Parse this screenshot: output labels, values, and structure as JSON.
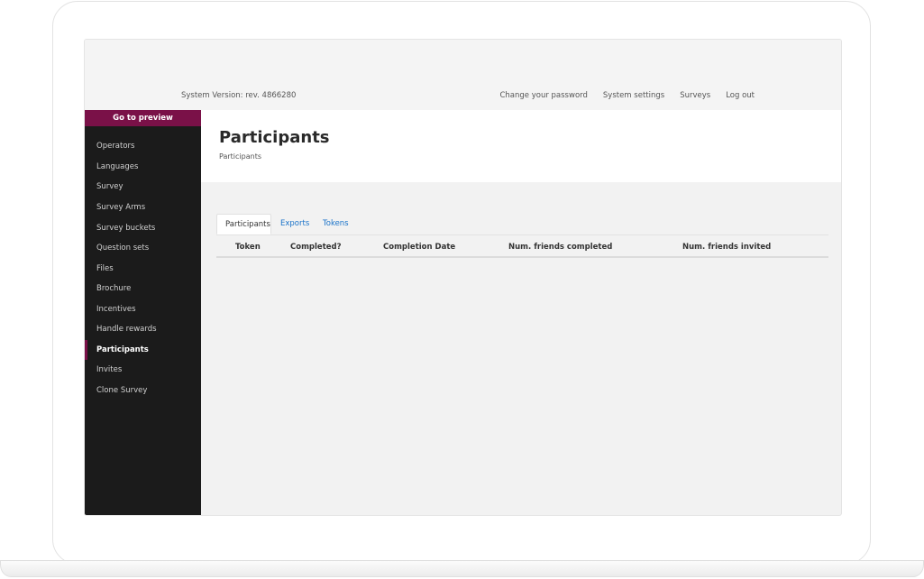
{
  "topbar": {
    "system_version": "System Version: rev. 4866280",
    "nav": [
      "Change your password",
      "System settings",
      "Surveys",
      "Log out"
    ]
  },
  "sidebar": {
    "preview_label": "Go to preview",
    "items": [
      {
        "label": "Operators"
      },
      {
        "label": "Languages"
      },
      {
        "label": "Survey"
      },
      {
        "label": "Survey Arms"
      },
      {
        "label": "Survey buckets"
      },
      {
        "label": "Question sets"
      },
      {
        "label": "Files"
      },
      {
        "label": "Brochure"
      },
      {
        "label": "Incentives"
      },
      {
        "label": "Handle rewards"
      },
      {
        "label": "Participants",
        "active": true
      },
      {
        "label": "Invites"
      },
      {
        "label": "Clone Survey"
      }
    ]
  },
  "header": {
    "title": "Participants",
    "breadcrumb": "Participants"
  },
  "tabs": [
    "Participants",
    "Exports",
    "Tokens"
  ],
  "table": {
    "columns": [
      "Token",
      "Completed?",
      "Completion Date",
      "Num. friends completed",
      "Num. friends invited"
    ]
  },
  "colors": {
    "accent": "#7a1148",
    "sidebar_bg": "#1b1b1b",
    "link": "#1a73c9"
  }
}
